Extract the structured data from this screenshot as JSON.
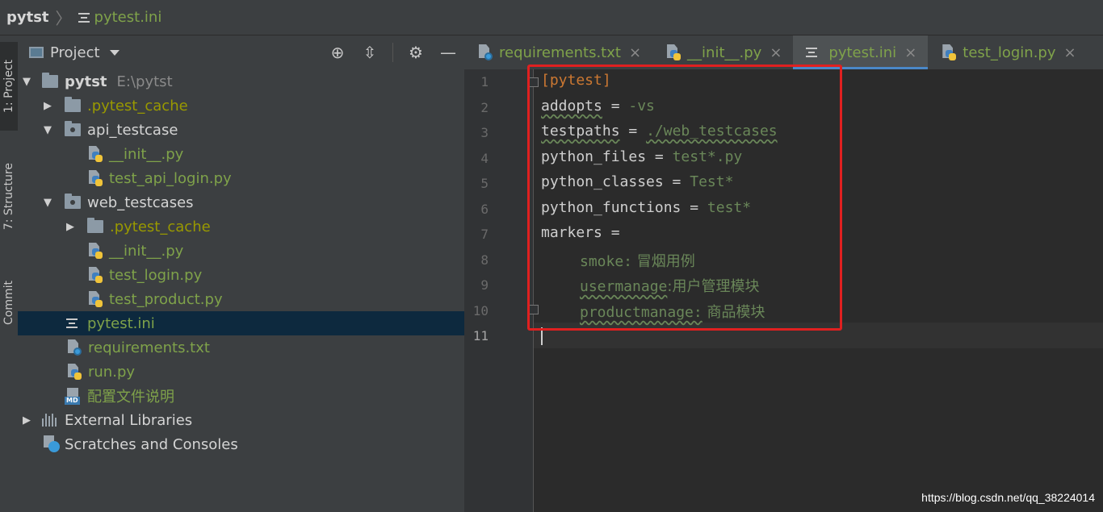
{
  "breadcrumb": {
    "root": "pytst",
    "file": "pytest.ini"
  },
  "side_tabs": [
    "1: Project",
    "7: Structure",
    "Commit"
  ],
  "project_panel": {
    "title": "Project"
  },
  "tree": [
    {
      "label": "pytst",
      "extra": "E:\\pytst"
    },
    {
      "label": ".pytest_cache"
    },
    {
      "label": "api_testcase"
    },
    {
      "label": "__init__.py"
    },
    {
      "label": "test_api_login.py"
    },
    {
      "label": "web_testcases"
    },
    {
      "label": ".pytest_cache"
    },
    {
      "label": "__init__.py"
    },
    {
      "label": "test_login.py"
    },
    {
      "label": "test_product.py"
    },
    {
      "label": "pytest.ini"
    },
    {
      "label": "requirements.txt"
    },
    {
      "label": "run.py"
    },
    {
      "label": "配置文件说明"
    },
    {
      "label": "External Libraries"
    },
    {
      "label": "Scratches and Consoles"
    }
  ],
  "tabs": [
    {
      "label": "requirements.txt",
      "close": "×"
    },
    {
      "label": "__init__.py",
      "close": "×"
    },
    {
      "label": "pytest.ini",
      "close": "×",
      "active": true
    },
    {
      "label": "test_login.py",
      "close": "×"
    }
  ],
  "line_numbers": [
    "1",
    "2",
    "3",
    "4",
    "5",
    "6",
    "7",
    "8",
    "9",
    "10",
    "11"
  ],
  "code": {
    "l1": "[pytest]",
    "l2k": "addopts",
    "l2o": " = ",
    "l2v": "-vs",
    "l3k": "testpaths",
    "l3o": " = ",
    "l3v": "./web_testcases",
    "l4k": "python_files",
    "l4o": " = ",
    "l4v": "test*.py",
    "l5k": "python_classes",
    "l5o": " = ",
    "l5v": "Test*",
    "l6k": "python_functions",
    "l6o": " = ",
    "l6v": "test*",
    "l7k": "markers",
    "l7o": " =",
    "l8a": "smoke:",
    "l8b": " 冒烟用例",
    "l9a": "usermanage",
    "l9b": ":用户管理模块",
    "l10a": "productmanage:",
    "l10b": " 商品模块"
  },
  "watermark": "https://blog.csdn.net/qq_38224014",
  "colors": {
    "highlight_box": "#e02020",
    "selection": "#0d293e",
    "accent": "#4a88c7"
  }
}
